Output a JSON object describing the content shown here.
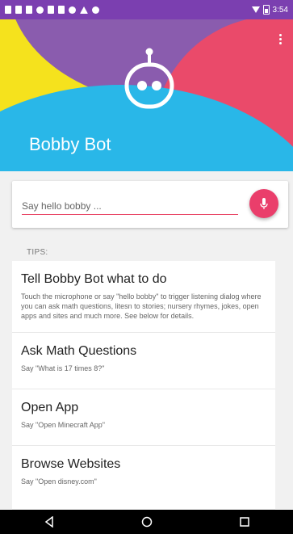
{
  "status_bar": {
    "time": "3:54"
  },
  "header": {
    "title": "Bobby Bot"
  },
  "search": {
    "placeholder": "Say hello bobby ..."
  },
  "tips": {
    "label": "TIPS:",
    "items": [
      {
        "title": "Tell Bobby Bot what to do",
        "desc": "Touch the microphone or say \"hello bobby\" to trigger listening dialog where you can ask math questions, litesn to stories; nursery rhymes, jokes, open apps and sites and much more. See below for details."
      },
      {
        "title": "Ask Math Questions",
        "desc": "Say \"What is 17 times 8?\""
      },
      {
        "title": "Open App",
        "desc": "Say \"Open Minecraft App\""
      },
      {
        "title": "Browse Websites",
        "desc": "Say \"Open disney.com\""
      }
    ]
  },
  "colors": {
    "purple": "#8a5cae",
    "yellow": "#f5e21d",
    "pink": "#ea4a6a",
    "blue": "#29b7e8",
    "accent": "#ea3e6b"
  },
  "icons": [
    "robot-icon",
    "overflow-menu-icon",
    "microphone-icon",
    "back-icon",
    "home-icon",
    "recents-icon",
    "wifi-icon",
    "battery-icon"
  ]
}
